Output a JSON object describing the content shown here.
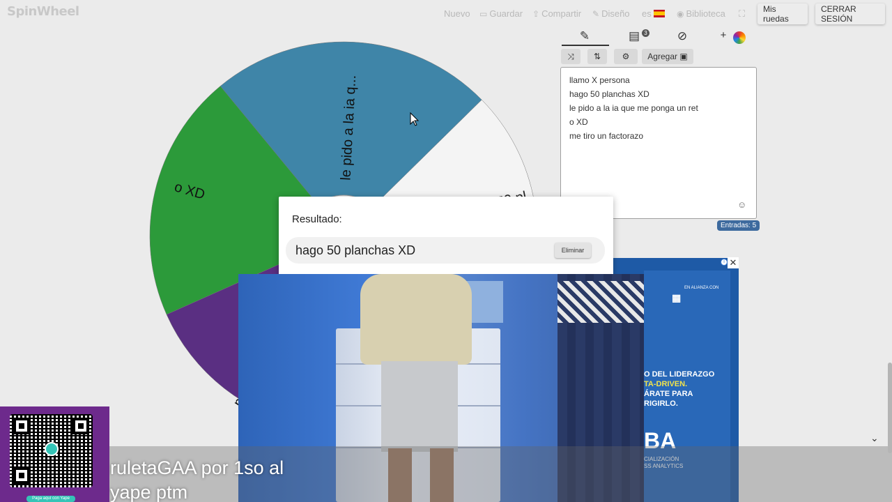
{
  "app": {
    "logo": "SpinWheel"
  },
  "topbar": {
    "new_label": "Nuevo",
    "save_label": "Guardar",
    "share_label": "Compartir",
    "design_label": "Diseño",
    "lang_label": "es",
    "library_label": "Biblioteca",
    "my_wheels_label": "Mis ruedas",
    "logout_label": "CERRAR SESIÓN"
  },
  "wheel": {
    "segments": [
      {
        "label": "le pido a la ia q...",
        "color": "#3f85a8"
      },
      {
        "label": "o XD",
        "color": "#2c9a3a"
      },
      {
        "label": "me tiro un...",
        "color": "#5a2f82"
      },
      {
        "label": "hago 50 pl...",
        "color": "#f4f4f4"
      }
    ]
  },
  "panel": {
    "clipboard_badge": "3",
    "add_label": "Agregar",
    "entries": [
      "llamo X persona",
      "hago 50 planchas XD",
      "le pido a la ia que me ponga un ret",
      "o XD",
      "me tiro un factorazo"
    ],
    "entries_count_label": "Entradas: 5"
  },
  "result_modal": {
    "title": "Resultado:",
    "result": "hago 50 planchas XD",
    "remove_label": "Eliminar"
  },
  "ad": {
    "top_text": "EN ALIANZA CON",
    "lines": [
      "O DEL LIDERAZGO",
      "TA-DRIVEN.",
      "ÁRATE PARA",
      "RIGIRLO."
    ],
    "big_text": "BA",
    "sub_lines": [
      "CIALIZACIÓN",
      "SS ANALYTICS"
    ]
  },
  "overlay": {
    "caption_line1": "ruletaGAA por 1so al",
    "caption_line2": "yape ptm",
    "yape_tag": "Paga aquí con Yape"
  }
}
